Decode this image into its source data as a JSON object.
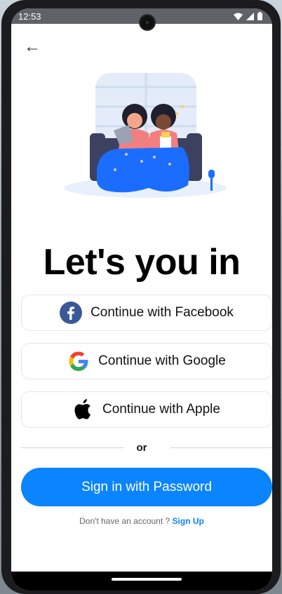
{
  "status_bar": {
    "time": "12:53",
    "icons": [
      "wifi-icon",
      "signal-icon",
      "battery-icon"
    ]
  },
  "back_button": {
    "icon": "back-arrow-icon",
    "glyph": "←"
  },
  "title": "Let's you in",
  "social_buttons": [
    {
      "label": "Continue with Facebook",
      "icon": "facebook-icon"
    },
    {
      "label": "Continue with Google",
      "icon": "google-icon"
    },
    {
      "label": "Continue with Apple",
      "icon": "apple-icon"
    }
  ],
  "divider_text": "or",
  "primary_button": {
    "label": "Sign in with Password"
  },
  "footer": {
    "prompt": "Don't have an account ?",
    "link": "Sign Up"
  },
  "colors": {
    "primary": "#0a84ff",
    "facebook": "#3b5998",
    "illustration_blanket": "#1a6dff",
    "illustration_bg": "#e8f0fb"
  }
}
